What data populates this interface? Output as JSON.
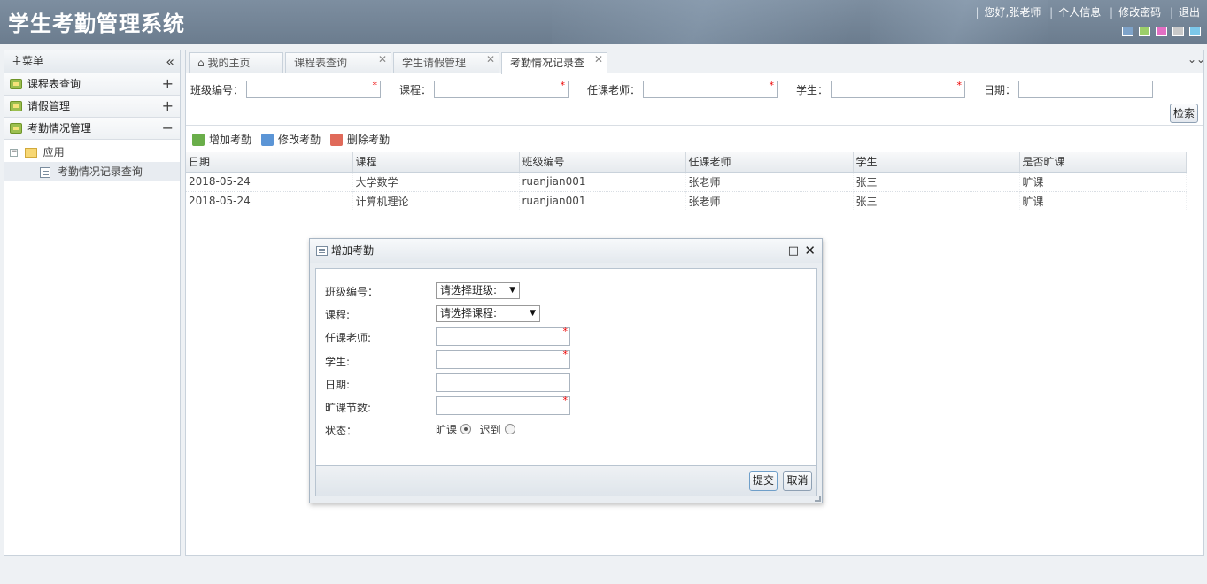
{
  "app": {
    "title": "学生考勤管理系统",
    "greeting": "您好,张老师",
    "links": [
      "个人信息",
      "修改密码",
      "退出"
    ],
    "themes": [
      "#7ea3c9",
      "#9ccf6a",
      "#e36fc4",
      "#c9c9c9",
      "#7cc8ea"
    ]
  },
  "sidebar": {
    "title": "主菜单",
    "collapse_icon": "«",
    "accordions": [
      {
        "label": "课程表查询",
        "toggle": "+"
      },
      {
        "label": "请假管理",
        "toggle": "+"
      },
      {
        "label": "考勤情况管理",
        "toggle": "−"
      }
    ],
    "tree": {
      "root_toggle": "−",
      "root": "应用",
      "child": "考勤情况记录查询"
    }
  },
  "tabs": [
    {
      "label": "我的主页",
      "closable": false
    },
    {
      "label": "课程表查询",
      "closable": true
    },
    {
      "label": "学生请假管理",
      "closable": true
    },
    {
      "label": "考勤情况记录查",
      "closable": true
    }
  ],
  "tab_close": "✕",
  "home_icon": "⌂",
  "search": {
    "fields": [
      {
        "label": "班级编号：",
        "required": true
      },
      {
        "label": "课程：",
        "required": true
      },
      {
        "label": "任课老师：",
        "required": true
      },
      {
        "label": "学生：",
        "required": true
      },
      {
        "label": "日期：",
        "required": false
      }
    ],
    "button": "检索",
    "required_mark": "*"
  },
  "toolbar": {
    "add": "增加考勤",
    "edit": "修改考勤",
    "delete": "删除考勤"
  },
  "grid": {
    "columns": [
      "日期",
      "课程",
      "班级编号",
      "任课老师",
      "学生",
      "是否旷课"
    ],
    "rows": [
      [
        "2018-05-24",
        "大学数学",
        "ruanjian001",
        "张老师",
        "张三",
        "旷课"
      ],
      [
        "2018-05-24",
        "计算机理论",
        "ruanjian001",
        "张老师",
        "张三",
        "旷课"
      ]
    ]
  },
  "dialog": {
    "title": "增加考勤",
    "fields": {
      "class_label": "班级编号：",
      "class_select": "请选择班级:",
      "course_label": "课程:",
      "course_select": "请选择课程:",
      "teacher_label": "任课老师:",
      "student_label": "学生:",
      "date_label": "日期:",
      "hours_label": "旷课节数:",
      "status_label": "状态：",
      "status_options": [
        "旷课",
        "迟到"
      ],
      "status_selected": "旷课"
    },
    "submit": "提交",
    "cancel": "取消",
    "select_arrow": "▼",
    "max_icon": "□",
    "close_icon": "✕"
  }
}
